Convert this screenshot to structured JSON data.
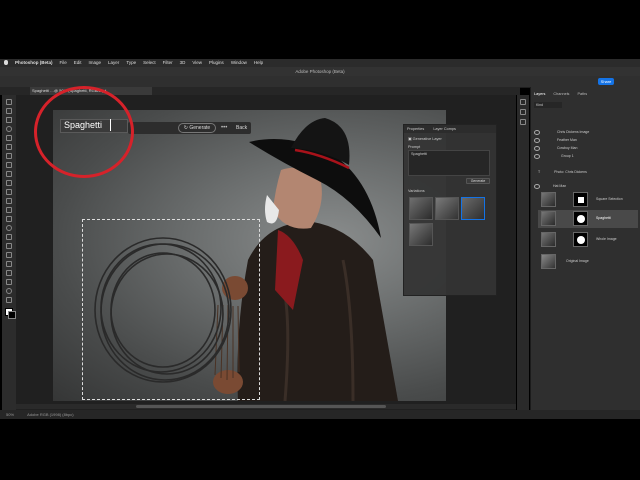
{
  "menubar": {
    "items": [
      "Photoshop (Beta)",
      "File",
      "Edit",
      "Image",
      "Layer",
      "Type",
      "Select",
      "Filter",
      "3D",
      "View",
      "Plugins",
      "Window",
      "Help"
    ]
  },
  "titlebar": {
    "title": "Adobe Photoshop (Beta)"
  },
  "optionsbar": {
    "share_label": "Share"
  },
  "document": {
    "tab_label": "Spaghetti …@ 50% (Spaghetti, RGB/8*) *"
  },
  "generative": {
    "prompt_value": "Spaghetti",
    "generate_label": "Generate",
    "more_label": "•••",
    "back_label": "Back"
  },
  "properties": {
    "tab_properties": "Properties",
    "tab_layer_comps": "Layer Comps",
    "layer_type": "Generative Layer",
    "prompt_label": "Prompt",
    "prompt_value": "Spaghetti",
    "generate_label": "Generate",
    "variations_label": "Variations"
  },
  "layers_panel": {
    "tabs": [
      "Layers",
      "Channels",
      "Paths"
    ],
    "kind_label": "Kind",
    "layers": [
      {
        "name": "Chris Dickens Image"
      },
      {
        "name": "Feather Man"
      },
      {
        "name": "Cowboy Man"
      },
      {
        "name": "Group 1"
      },
      {
        "name": "Photo: Chris Dickens"
      },
      {
        "name": "Hat Man"
      },
      {
        "name": "Square Selection"
      },
      {
        "name": "Spaghetti"
      },
      {
        "name": "Whole Image"
      },
      {
        "name": "Original Image"
      }
    ]
  },
  "status": {
    "zoom": "50%",
    "doc_info": "Adobe RGB (1998) (8bpc)"
  },
  "colors": {
    "accent": "#1473e6",
    "highlight_circle": "#d6222a"
  }
}
